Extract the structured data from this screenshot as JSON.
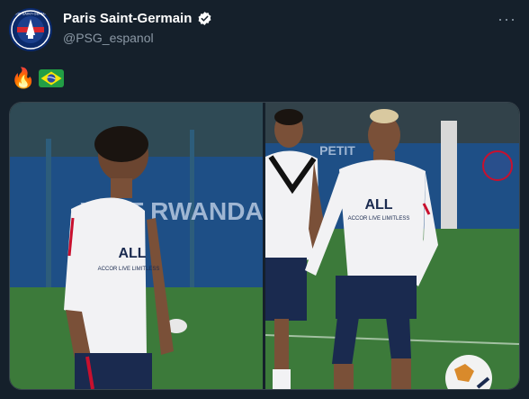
{
  "account": {
    "display_name": "Paris Saint-Germain",
    "handle": "@PSG_espanol",
    "avatar_text": "PARIS SAINT-GERMAIN"
  },
  "tweet": {
    "text_emojis": [
      "🔥",
      "🇧🇷"
    ]
  },
  "menu": {
    "more_label": "···"
  },
  "media": {
    "photo_count": 2,
    "left_photo": {
      "banner_text": "VISIT RWANDA",
      "shirt_text": "ALL",
      "shirt_subtext": "ACCOR LIVE LIMITLESS"
    },
    "right_photo": {
      "banner_text": "PETIT",
      "shirt_text": "ALL",
      "shirt_subtext": "ACCOR LIVE LIMITLESS"
    }
  },
  "colors": {
    "background": "#15202b",
    "verified_badge": "#ffffff",
    "handle_text": "#8b98a5",
    "pitch_green": "#3c7a3a",
    "banner_blue": "#1e4f86"
  }
}
